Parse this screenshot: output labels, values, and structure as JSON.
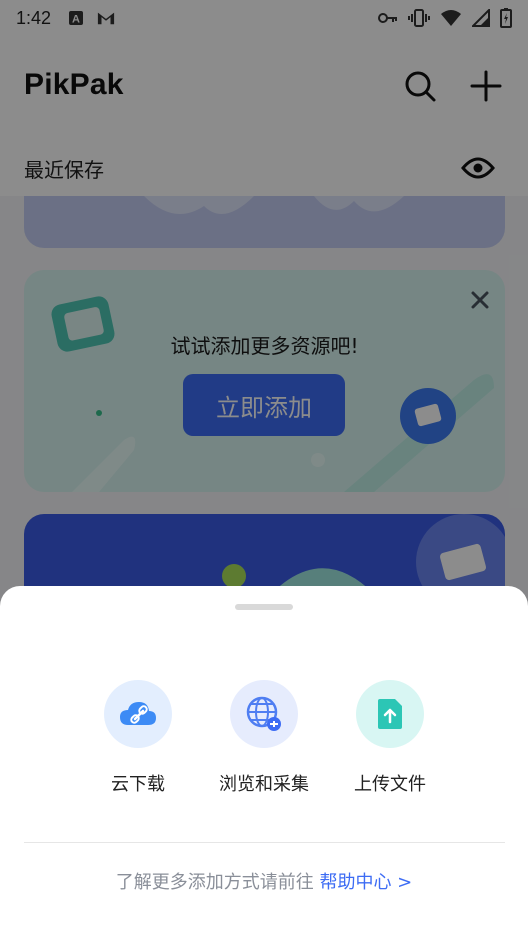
{
  "status_bar": {
    "time": "1:42",
    "left_icons": [
      "font-a-icon",
      "gmail-icon"
    ],
    "right_icons": [
      "key-icon",
      "vibrate-icon",
      "wifi-icon",
      "signal-icon",
      "battery-icon"
    ]
  },
  "header": {
    "title": "PikPak",
    "search_icon": "search-icon",
    "add_icon": "plus-icon"
  },
  "section": {
    "title": "最近保存",
    "eye_icon": "eye-icon"
  },
  "promo_card": {
    "text": "试试添加更多资源吧!",
    "button_label": "立即添加",
    "close_icon": "close-icon"
  },
  "sheet": {
    "actions": [
      {
        "label": "云下载",
        "icon": "cloud-link-icon",
        "color": "#e3eefe"
      },
      {
        "label": "浏览和采集",
        "icon": "globe-collect-icon",
        "color": "#e6ecfd"
      },
      {
        "label": "上传文件",
        "icon": "upload-file-icon",
        "color": "#d8f6f3"
      }
    ],
    "help_text": "了解更多添加方式请前往",
    "help_link": "帮助中心 >"
  },
  "colors": {
    "accent": "#3d6cf4",
    "overlay": "rgba(0,0,0,0.45)"
  }
}
